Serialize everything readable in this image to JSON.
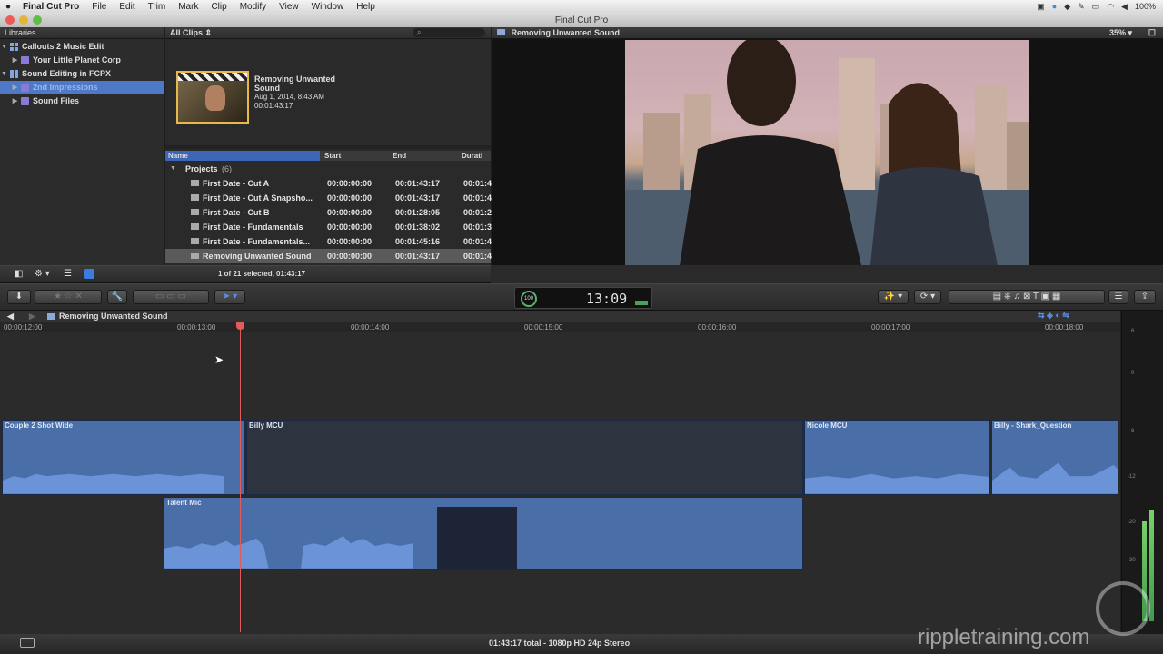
{
  "menubar": {
    "items": [
      "Final Cut Pro",
      "File",
      "Edit",
      "Trim",
      "Mark",
      "Clip",
      "Modify",
      "View",
      "Window",
      "Help"
    ],
    "battery": "100%"
  },
  "window": {
    "title": "Final Cut Pro"
  },
  "libraries": {
    "header": "Libraries",
    "items": [
      {
        "label": "Callouts 2 Music Edit",
        "type": "library"
      },
      {
        "label": "Your Little Planet Corp",
        "type": "event"
      },
      {
        "label": "Sound Editing in FCPX",
        "type": "library"
      },
      {
        "label": "2nd Impressions",
        "type": "event",
        "selected": true
      },
      {
        "label": "Sound Files",
        "type": "event"
      }
    ]
  },
  "browser": {
    "filter": "All Clips",
    "clip": {
      "title": "Removing Unwanted Sound",
      "date": "Aug 1, 2014, 8:43 AM",
      "duration": "00:01:43:17"
    },
    "columns": {
      "name": "Name",
      "start": "Start",
      "end": "End",
      "duration": "Durati"
    },
    "group": {
      "label": "Projects",
      "count": "(6)"
    },
    "rows": [
      {
        "name": "First Date - Cut A",
        "start": "00:00:00:00",
        "end": "00:01:43:17",
        "dur": "00:01:4"
      },
      {
        "name": "First Date - Cut A Snapsho...",
        "start": "00:00:00:00",
        "end": "00:01:43:17",
        "dur": "00:01:4"
      },
      {
        "name": "First Date - Cut B",
        "start": "00:00:00:00",
        "end": "00:01:28:05",
        "dur": "00:01:2"
      },
      {
        "name": "First Date - Fundamentals",
        "start": "00:00:00:00",
        "end": "00:01:38:02",
        "dur": "00:01:3"
      },
      {
        "name": "First Date - Fundamentals...",
        "start": "00:00:00:00",
        "end": "00:01:45:16",
        "dur": "00:01:4"
      },
      {
        "name": "Removing Unwanted Sound",
        "start": "00:00:00:00",
        "end": "00:01:43:17",
        "dur": "00:01:4",
        "selected": true
      }
    ],
    "status": "1 of 21 selected, 01:43:17"
  },
  "viewer": {
    "title": "Removing Unwanted Sound",
    "zoom": "35%"
  },
  "toolbar": {
    "timecode": "13:09",
    "percent": "100"
  },
  "timeline": {
    "project": "Removing Unwanted Sound",
    "ruler": [
      "00:00:12:00",
      "00:00:13:00",
      "00:00:14:00",
      "00:00:15:00",
      "00:00:16:00",
      "00:00:17:00",
      "00:00:18:00"
    ],
    "clips": {
      "c1": "Couple 2 Shot Wide",
      "c2": "Billy MCU",
      "c3": "Nicole MCU",
      "c4": "Billy - Shark_Question",
      "c5": "Talent Mic"
    }
  },
  "meters": {
    "scale": [
      "6",
      "0",
      "-6",
      "-12",
      "-20",
      "-30"
    ]
  },
  "statusbar": {
    "text": "01:43:17 total - 1080p HD 24p Stereo"
  },
  "watermark": "rippletraining.com"
}
